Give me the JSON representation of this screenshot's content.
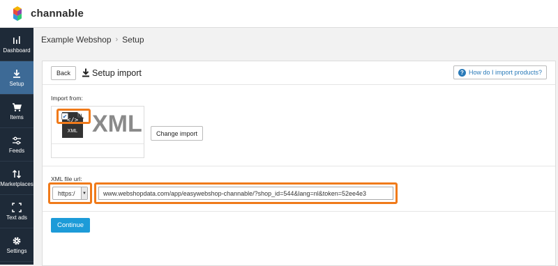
{
  "app": {
    "brand": "channable"
  },
  "sidebar": {
    "items": [
      {
        "label": "Dashboard",
        "icon": "bar-chart-icon",
        "active": false
      },
      {
        "label": "Setup",
        "icon": "download-icon",
        "active": true
      },
      {
        "label": "Items",
        "icon": "cart-icon",
        "active": false
      },
      {
        "label": "Feeds",
        "icon": "sliders-icon",
        "active": false
      },
      {
        "label": "Marketplaces",
        "icon": "swap-arrows-icon",
        "active": false
      },
      {
        "label": "Text ads",
        "icon": "expand-corners-icon",
        "active": false
      },
      {
        "label": "Settings",
        "icon": "gear-icon",
        "active": false
      }
    ]
  },
  "breadcrumb": {
    "project": "Example Webshop",
    "page": "Setup"
  },
  "header": {
    "back_label": "Back",
    "title": "Setup import",
    "help_label": "How do I import products?"
  },
  "import": {
    "from_label": "Import from:",
    "type_icon_code": "</>",
    "type_icon_text": "XML",
    "type_name": "XML",
    "checkbox_label": "XML",
    "checked": true,
    "change_label": "Change import"
  },
  "url": {
    "label": "XML file url:",
    "protocol": "https:/",
    "value": "www.webshopdata.com/app/easywebshop-channable/?shop_id=544&lang=nl&token=52ee4e3"
  },
  "continue_label": "Continue",
  "colors": {
    "accent": "#1d9bd8",
    "highlight": "#f07a1a",
    "sidebar": "#1e2a38",
    "sidebar_active": "#3d6a96"
  }
}
